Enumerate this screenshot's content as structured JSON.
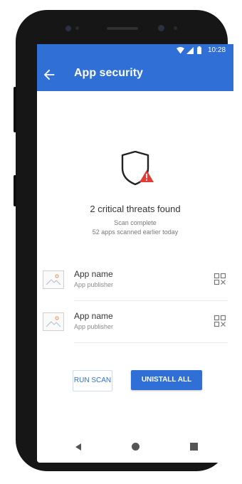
{
  "status_bar": {
    "time": "10:28",
    "icons": [
      "wifi-icon",
      "cell-signal-icon",
      "battery-icon"
    ]
  },
  "app_bar": {
    "title": "App security",
    "back_icon": "arrow-left-icon"
  },
  "summary": {
    "icon": "shield-warning-icon",
    "heading": "2 critical threats found",
    "line1": "Scan complete",
    "line2": "52 apps scanned earlier today"
  },
  "apps": [
    {
      "name": "App name",
      "publisher": "App publisher",
      "thumb_icon": "image-placeholder-icon",
      "action_icon": "app-action-icon"
    },
    {
      "name": "App name",
      "publisher": "App publisher",
      "thumb_icon": "image-placeholder-icon",
      "action_icon": "app-action-icon"
    }
  ],
  "actions": {
    "run_scan": "RUN SCAN",
    "uninstall_all": "UNISTALL ALL"
  },
  "nav_bar": {
    "buttons": [
      "back-triangle-icon",
      "home-circle-icon",
      "recents-square-icon"
    ]
  },
  "colors": {
    "primary": "#2f6fd6",
    "warning": "#e53935",
    "phone_body": "#161616"
  }
}
